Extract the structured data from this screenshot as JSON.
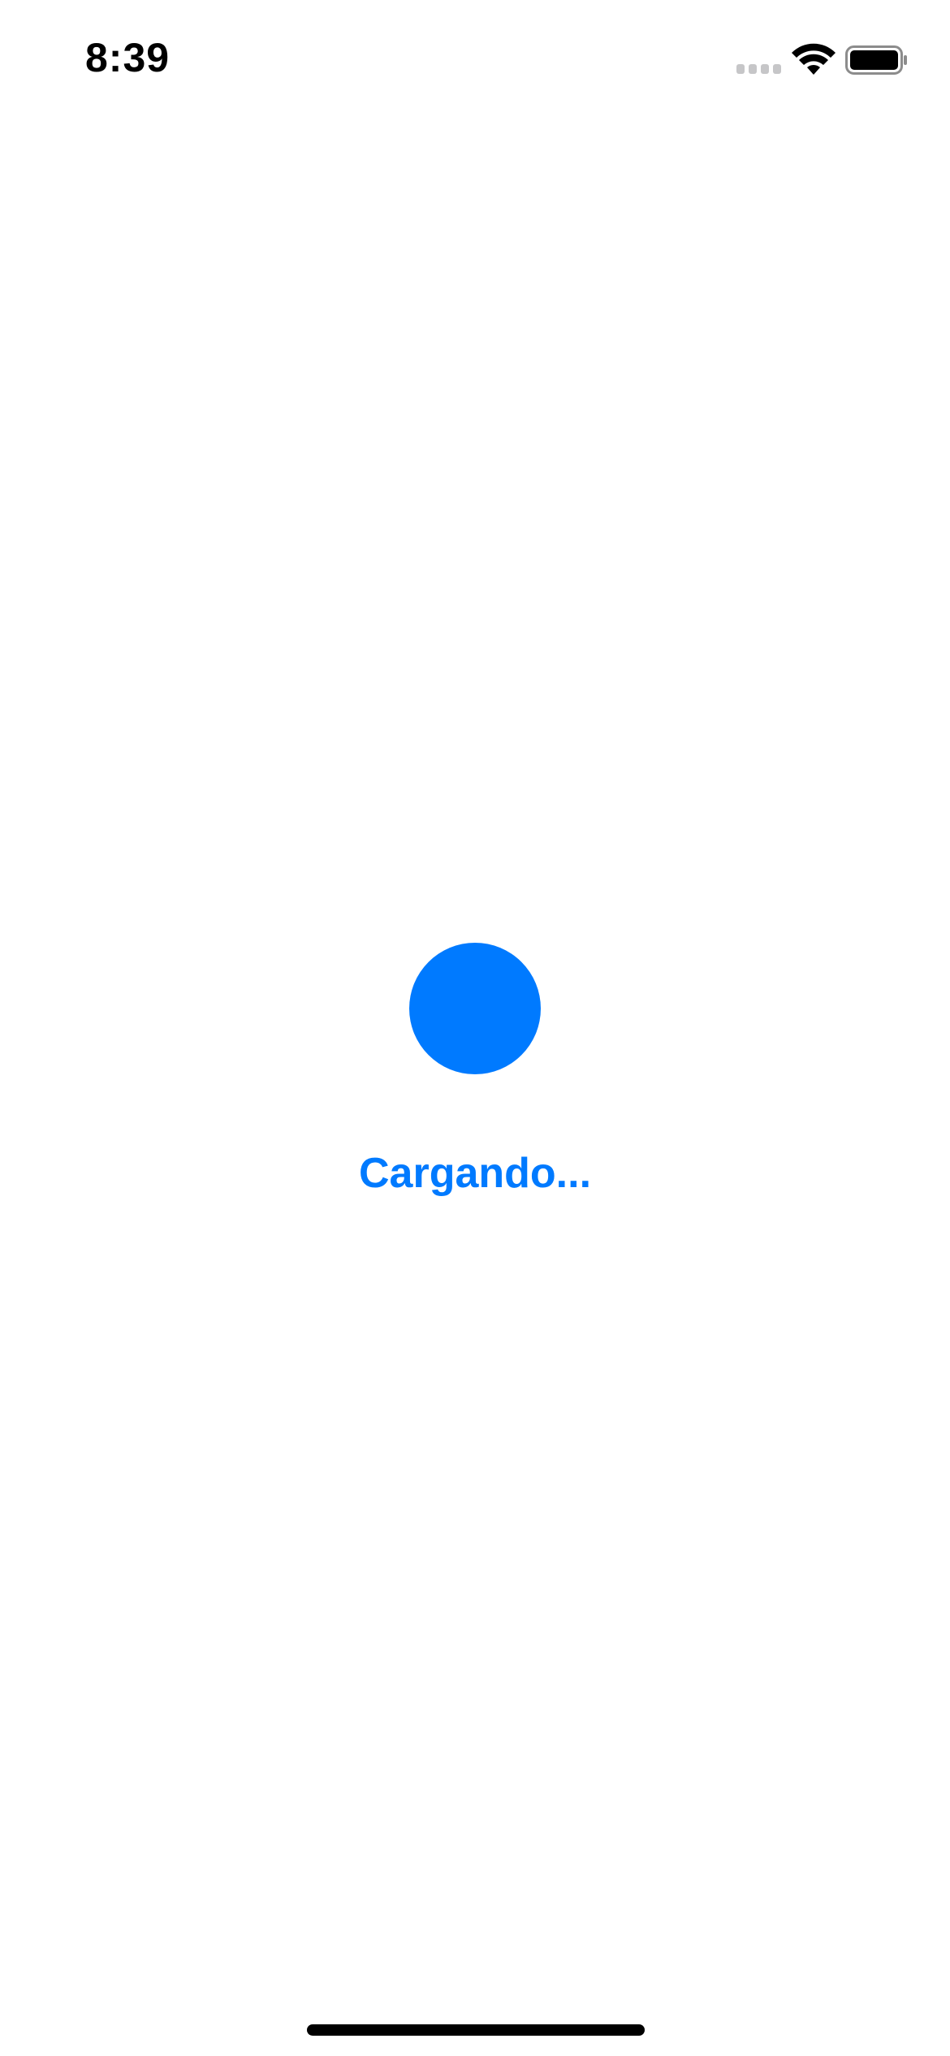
{
  "status_bar": {
    "time": "8:39",
    "signal_icon": "cellular-signal-no-service",
    "wifi_icon": "wifi-full",
    "battery_icon": "battery-full"
  },
  "loading": {
    "text": "Cargando...",
    "indicator_icon": "loading-dot"
  },
  "colors": {
    "accent": "#007aff",
    "background": "#ffffff",
    "text_primary": "#000000",
    "inactive_signal": "#c6c6c8"
  }
}
